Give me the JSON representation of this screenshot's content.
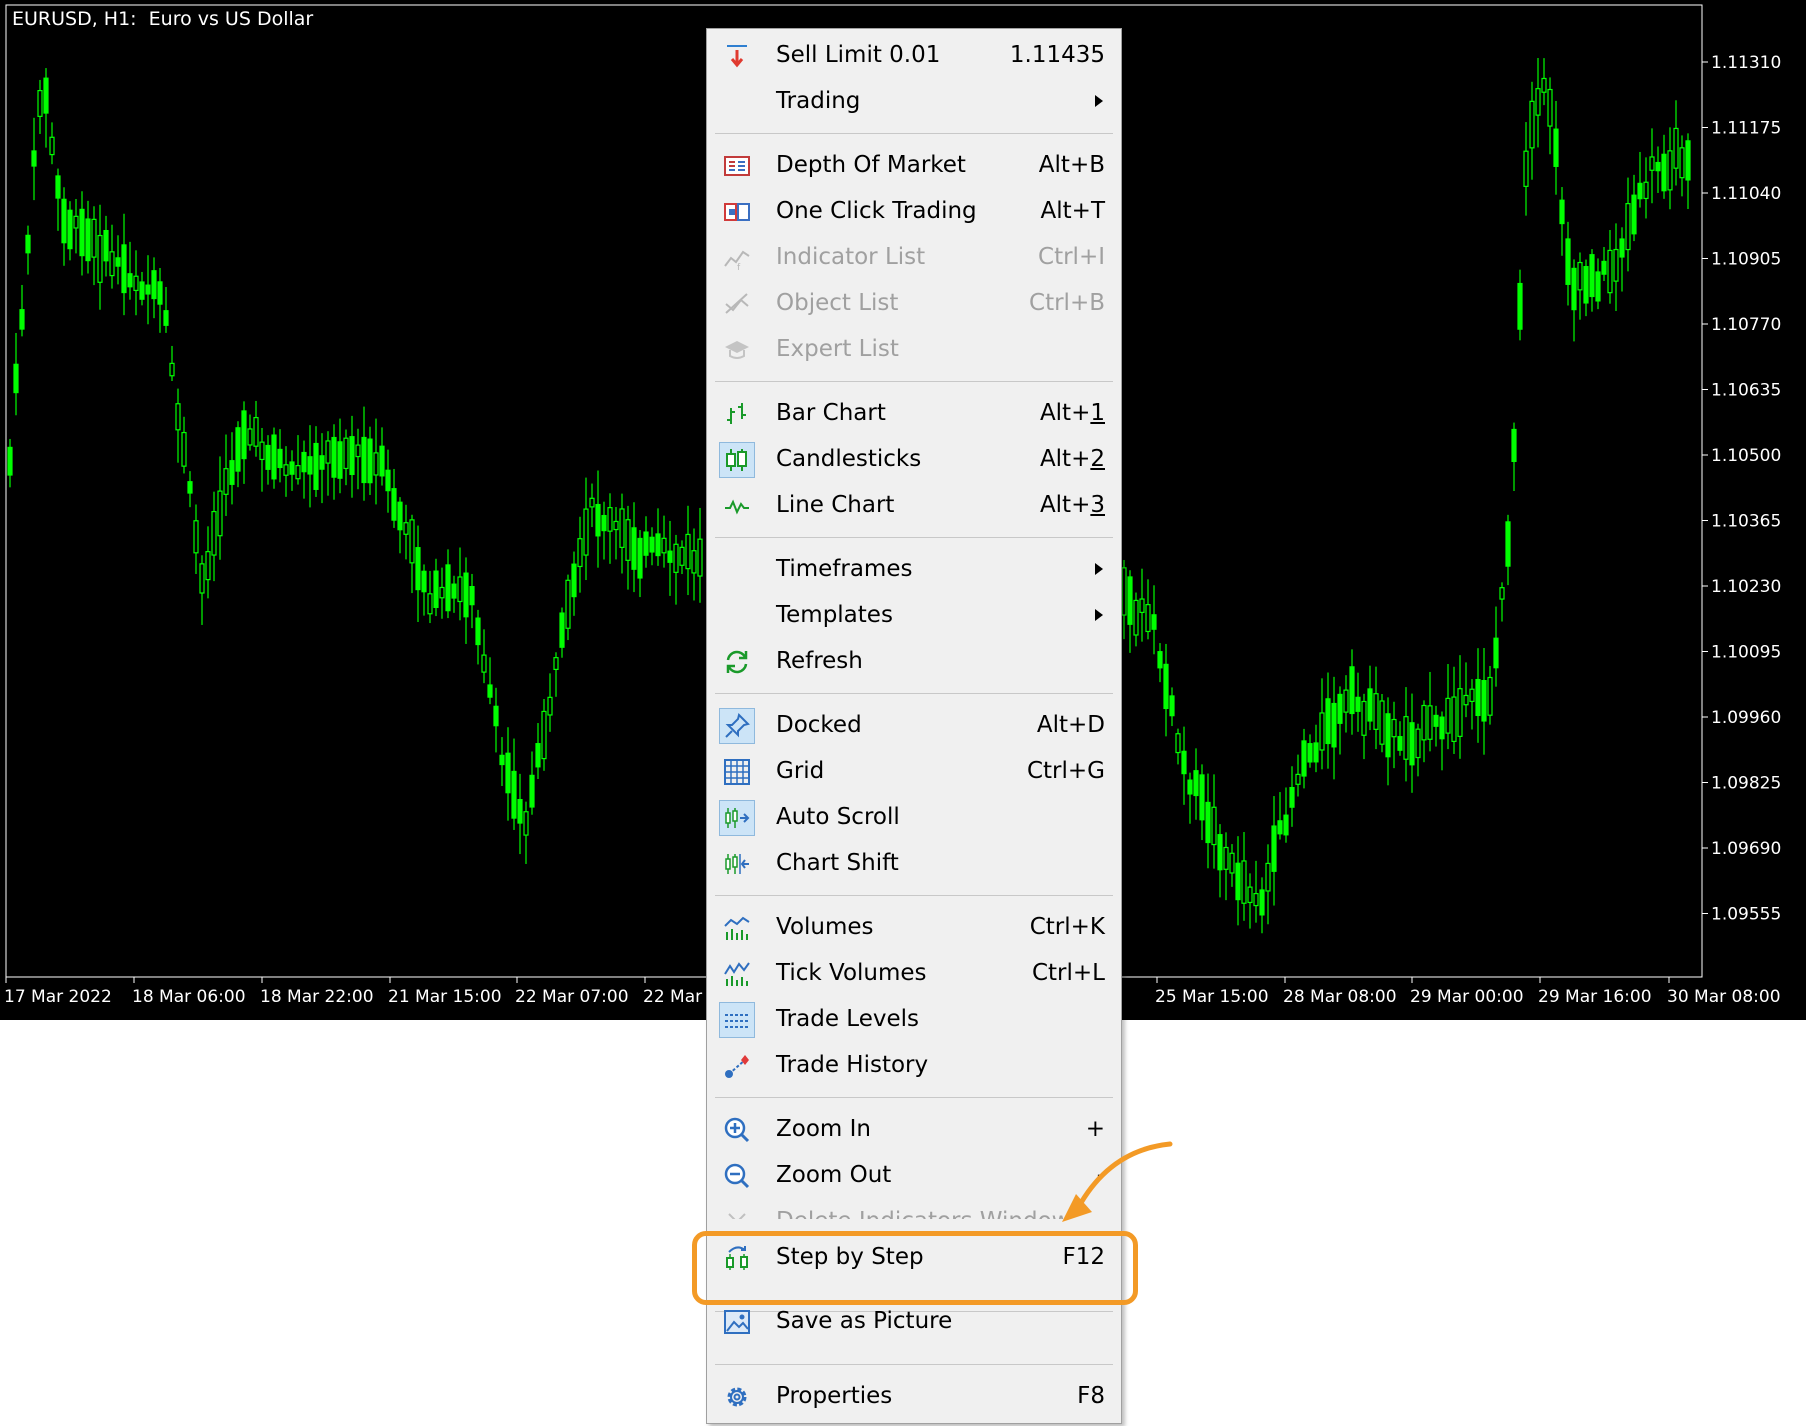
{
  "chart": {
    "title": "EURUSD, H1:  Euro vs US Dollar",
    "background": "#000000",
    "candle_color": "#00ff00",
    "price_labels": [
      "1.11310",
      "1.11175",
      "1.11040",
      "1.10905",
      "1.10770",
      "1.10635",
      "1.10500",
      "1.10365",
      "1.10230",
      "1.10095",
      "1.09960",
      "1.09825",
      "1.09690",
      "1.09555"
    ],
    "time_labels": [
      "17 Mar 2022",
      "18 Mar 06:00",
      "18 Mar 22:00",
      "21 Mar 15:00",
      "22 Mar 07:00",
      "22 Mar",
      "25 Mar 15:00",
      "28 Mar 08:00",
      "29 Mar 00:00",
      "29 Mar 16:00",
      "30 Mar 08:00"
    ]
  },
  "menu": {
    "items": [
      {
        "label": "Sell Limit 0.01",
        "shortcut": "1.11435",
        "icon": "sell-limit-icon"
      },
      {
        "label": "Trading",
        "submenu": true
      },
      {
        "label": "Depth Of Market",
        "shortcut": "Alt+B",
        "icon": "depth-of-market-icon"
      },
      {
        "label": "One Click Trading",
        "shortcut": "Alt+T",
        "icon": "one-click-trading-icon"
      },
      {
        "label": "Indicator List",
        "shortcut": "Ctrl+I",
        "icon": "indicator-list-icon",
        "disabled": true
      },
      {
        "label": "Object List",
        "shortcut": "Ctrl+B",
        "icon": "object-list-icon",
        "disabled": true
      },
      {
        "label": "Expert List",
        "icon": "expert-list-icon",
        "disabled": true
      },
      {
        "label": "Bar Chart",
        "shortcut_prefix": "Alt+",
        "shortcut_key": "1",
        "icon": "bar-chart-icon"
      },
      {
        "label": "Candlesticks",
        "shortcut_prefix": "Alt+",
        "shortcut_key": "2",
        "icon": "candlesticks-icon",
        "checked": true
      },
      {
        "label": "Line Chart",
        "shortcut_prefix": "Alt+",
        "shortcut_key": "3",
        "icon": "line-chart-icon"
      },
      {
        "label": "Timeframes",
        "submenu": true
      },
      {
        "label": "Templates",
        "submenu": true
      },
      {
        "label": "Refresh",
        "icon": "refresh-icon"
      },
      {
        "label": "Docked",
        "shortcut": "Alt+D",
        "icon": "pin-icon",
        "checked": true
      },
      {
        "label": "Grid",
        "shortcut": "Ctrl+G",
        "icon": "grid-icon"
      },
      {
        "label": "Auto Scroll",
        "icon": "auto-scroll-icon",
        "checked": true
      },
      {
        "label": "Chart Shift",
        "icon": "chart-shift-icon"
      },
      {
        "label": "Volumes",
        "shortcut": "Ctrl+K",
        "icon": "volumes-icon"
      },
      {
        "label": "Tick Volumes",
        "shortcut": "Ctrl+L",
        "icon": "tick-volumes-icon"
      },
      {
        "label": "Trade Levels",
        "icon": "trade-levels-icon",
        "checked": true
      },
      {
        "label": "Trade History",
        "icon": "trade-history-icon"
      },
      {
        "label": "Zoom In",
        "shortcut": "+",
        "icon": "zoom-in-icon"
      },
      {
        "label": "Zoom Out",
        "shortcut": "-",
        "icon": "zoom-out-icon"
      },
      {
        "label": "Delete Indicators Window",
        "icon": "delete-icon",
        "disabled": true
      },
      {
        "label": "Step by Step",
        "shortcut": "F12",
        "icon": "step-by-step-icon"
      },
      {
        "label": "Save as Picture",
        "icon": "save-picture-icon"
      },
      {
        "label": "Properties",
        "shortcut": "F8",
        "icon": "properties-icon"
      }
    ]
  },
  "highlight": {
    "color": "#f39a26"
  }
}
